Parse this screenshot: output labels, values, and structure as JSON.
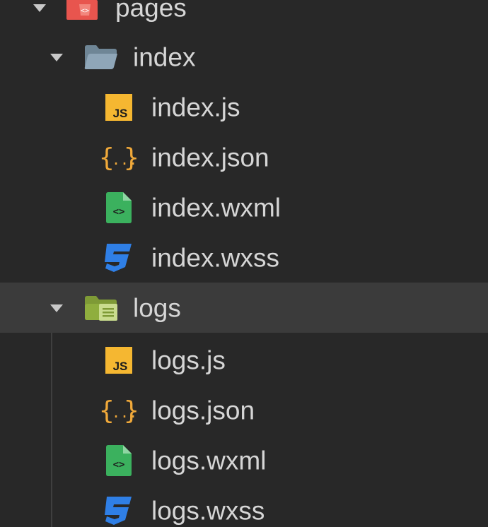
{
  "tree": {
    "pages": {
      "label": "pages",
      "icon": "pages-folder-icon",
      "expanded": true
    },
    "index": {
      "label": "index",
      "icon": "folder-open-icon",
      "expanded": true,
      "files": [
        {
          "label": "index.js",
          "icon": "js-file-icon"
        },
        {
          "label": "index.json",
          "icon": "json-file-icon"
        },
        {
          "label": "index.wxml",
          "icon": "wxml-file-icon"
        },
        {
          "label": "index.wxss",
          "icon": "wxss-file-icon"
        }
      ]
    },
    "logs": {
      "label": "logs",
      "icon": "folder-open-icon",
      "expanded": true,
      "selected": true,
      "files": [
        {
          "label": "logs.js",
          "icon": "js-file-icon"
        },
        {
          "label": "logs.json",
          "icon": "json-file-icon"
        },
        {
          "label": "logs.wxml",
          "icon": "wxml-file-icon"
        },
        {
          "label": "logs.wxss",
          "icon": "wxss-file-icon"
        }
      ]
    }
  },
  "colors": {
    "background": "#282828",
    "selected_row": "#3b3b3b",
    "text": "#d6d6d6",
    "js_badge": "#f5b731",
    "json_braces": "#f0a93a",
    "wxml": "#3bb15e",
    "wxss": "#2f7fe6",
    "index_folder": "#8fa6b8",
    "logs_folder": "#8fae3e",
    "pages_folder": "#e8554e"
  }
}
